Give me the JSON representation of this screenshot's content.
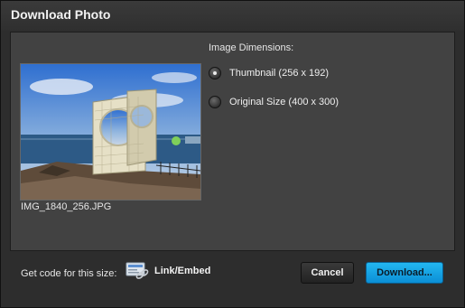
{
  "dialog": {
    "title": "Download Photo"
  },
  "image": {
    "filename": "IMG_1840_256.JPG"
  },
  "dimensions": {
    "title": "Image Dimensions:",
    "options": [
      {
        "label": "Thumbnail (256 x 192)",
        "selected": true
      },
      {
        "label": "Original Size (400 x 300)",
        "selected": false
      }
    ]
  },
  "footer": {
    "code_label": "Get code for this size:",
    "link_embed_label": "Link/Embed",
    "cancel_label": "Cancel",
    "download_label": "Download..."
  },
  "colors": {
    "accent": "#1aa7ea",
    "panel": "#424242",
    "title_bar": "#353535"
  },
  "icons": {
    "link_embed": "link-embed-icon",
    "radio": "radio-button-icon"
  }
}
